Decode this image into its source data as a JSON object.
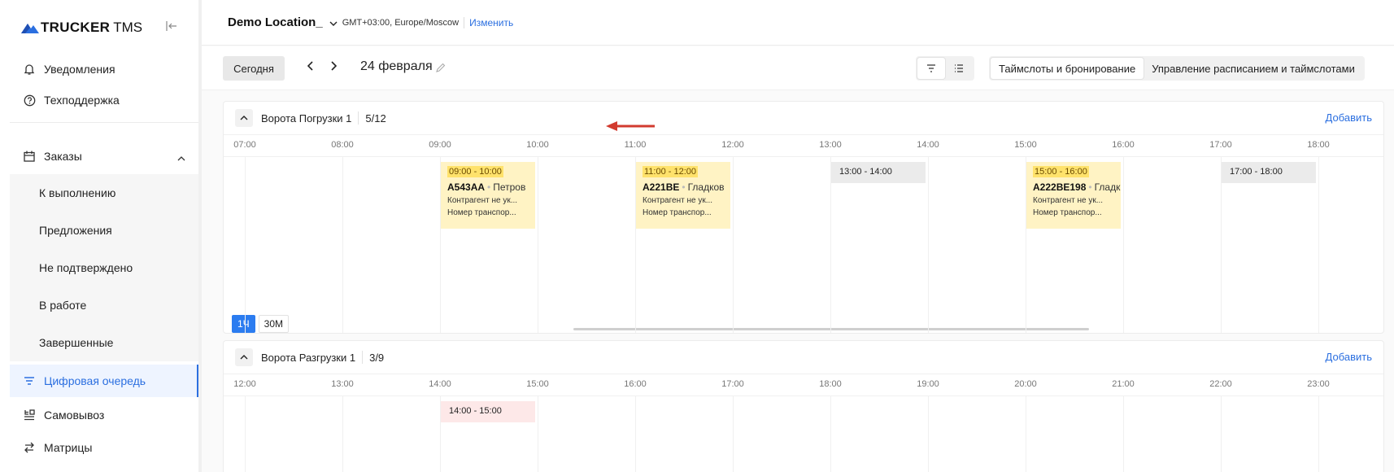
{
  "brand": {
    "name_bold": "TRUCKER",
    "name_rest": "TMS"
  },
  "sidebar": {
    "top_items": [
      {
        "label": "Уведомления",
        "icon": "bell-icon"
      },
      {
        "label": "Техподдержка",
        "icon": "help-circle-icon"
      }
    ],
    "orders": {
      "label": "Заказы",
      "icon": "calendar-icon",
      "expanded": true,
      "children": [
        "К выполнению",
        "Предложения",
        "Не подтверждено",
        "В работе",
        "Завершенные"
      ]
    },
    "bottom_items": [
      {
        "label": "Цифровая очередь",
        "icon": "queue-icon",
        "active": true
      },
      {
        "label": "Самовывоз",
        "icon": "pickup-icon"
      },
      {
        "label": "Матрицы",
        "icon": "swap-icon"
      }
    ]
  },
  "topbar": {
    "location": "Demo Location_",
    "timezone": "GMT+03:00, Europe/Moscow",
    "change_label": "Изменить"
  },
  "toolbar": {
    "today_label": "Сегодня",
    "date_label": "24 февраля",
    "modes": [
      "Таймслоты и бронирование",
      "Управление расписанием и таймслотами"
    ],
    "active_mode": 0
  },
  "gates": [
    {
      "name": "Ворота Погрузки 1",
      "count": "5/12",
      "add_label": "Добавить",
      "hours": [
        "07:00",
        "08:00",
        "09:00",
        "10:00",
        "11:00",
        "12:00",
        "13:00",
        "14:00",
        "15:00",
        "16:00",
        "17:00",
        "18:00"
      ],
      "slots": [
        {
          "hour_index": 2,
          "time": "09:00 - 10:00",
          "status": "booked",
          "plate": "А543АА",
          "driver": "Петров",
          "line1": "Контрагент не ук...",
          "line2": "Номер транспор..."
        },
        {
          "hour_index": 4,
          "time": "11:00 - 12:00",
          "status": "booked",
          "plate": "А221ВЕ",
          "driver": "Гладков",
          "line1": "Контрагент не ук...",
          "line2": "Номер транспор..."
        },
        {
          "hour_index": 6,
          "time": "13:00 - 14:00",
          "status": "free"
        },
        {
          "hour_index": 8,
          "time": "15:00 - 16:00",
          "status": "booked",
          "plate": "А222ВЕ198",
          "driver": "Гладков",
          "line1": "Контрагент не ук...",
          "line2": "Номер транспор..."
        },
        {
          "hour_index": 10,
          "time": "17:00 - 18:00",
          "status": "free"
        }
      ],
      "scale_options": [
        "1Ч",
        "30М"
      ],
      "active_scale": 0
    },
    {
      "name": "Ворота Разгрузки 1",
      "count": "3/9",
      "add_label": "Добавить",
      "hours": [
        "12:00",
        "13:00",
        "14:00",
        "15:00",
        "16:00",
        "17:00",
        "18:00",
        "19:00",
        "20:00",
        "21:00",
        "22:00",
        "23:00"
      ],
      "slots": [
        {
          "hour_index": 2,
          "time": "14:00 - 15:00",
          "status": "free-pink"
        }
      ]
    }
  ],
  "colors": {
    "accent": "#2b6fe0",
    "booked": "#fff3c4",
    "booked_time": "#ffe26b",
    "arrow": "#d23b2f"
  }
}
